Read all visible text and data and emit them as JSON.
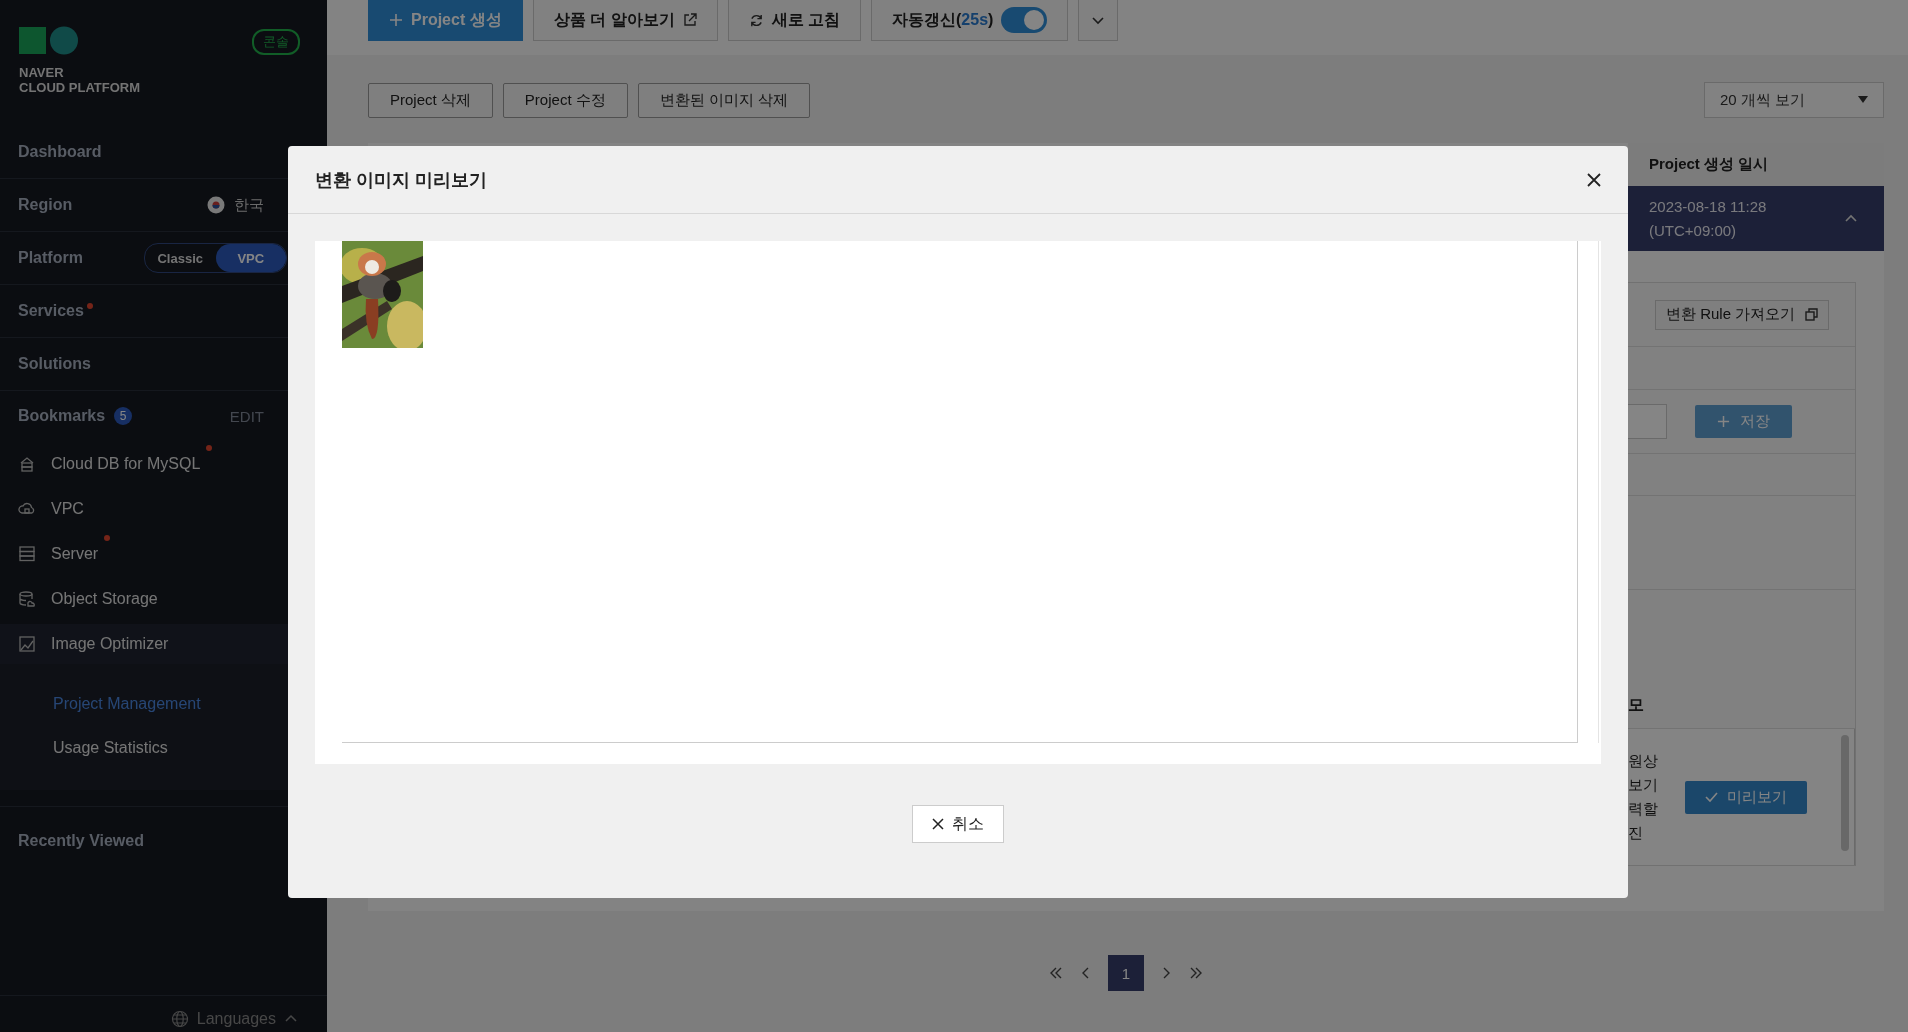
{
  "sidebar": {
    "logo": {
      "line1": "NAVER",
      "line2": "CLOUD PLATFORM"
    },
    "console_badge": "콘솔",
    "sections": [
      {
        "kind": "link",
        "label": "Dashboard",
        "new": false
      },
      {
        "kind": "region",
        "label": "Region",
        "value": "한국"
      },
      {
        "kind": "platform",
        "label": "Platform",
        "options": [
          {
            "label": "Classic",
            "selected": false
          },
          {
            "label": "VPC",
            "selected": true
          }
        ]
      },
      {
        "kind": "link",
        "label": "Services",
        "new": true
      },
      {
        "kind": "link",
        "label": "Solutions",
        "new": false
      }
    ],
    "bookmarks": {
      "label": "Bookmarks",
      "count": "5",
      "edit": "EDIT",
      "items": [
        {
          "kind": "cloud-db",
          "label": "Cloud DB for MySQL",
          "new": true,
          "expanded": false
        },
        {
          "kind": "vpc",
          "label": "VPC",
          "new": false,
          "expanded": false
        },
        {
          "kind": "server",
          "label": "Server",
          "new": true,
          "expanded": false
        },
        {
          "kind": "storage",
          "label": "Object Storage",
          "new": false,
          "expanded": false
        },
        {
          "kind": "optimizer",
          "label": "Image Optimizer",
          "new": false,
          "expanded": true,
          "children": [
            {
              "label": "Project Management",
              "selected": true
            },
            {
              "label": "Usage Statistics",
              "selected": false
            }
          ]
        }
      ]
    },
    "recent": "Recently Viewed",
    "languages": "Languages"
  },
  "toolbar": {
    "buttons": [
      {
        "kind": "primary",
        "label": "Project 생성"
      },
      {
        "kind": "external",
        "label": "상품 더 알아보기"
      },
      {
        "kind": "refresh",
        "label": "새로 고침"
      }
    ],
    "auto_refresh": {
      "label": "자동갱신(",
      "countdown": "25s",
      "close": ")",
      "on": true
    }
  },
  "actions": [
    "Project 삭제",
    "Project 수정",
    "변환된 이미지 삭제"
  ],
  "page_size": "20 개씩 보기",
  "table": {
    "columns": [
      "Project 생성 일시"
    ],
    "rows": [
      {
        "created": "2023-08-18 11:28",
        "timezone": "(UTC+09:00)",
        "selected": true,
        "expanded": true
      }
    ]
  },
  "detail": {
    "import_button": "변환 Rule 가져오기",
    "save_button": {
      "label": "저장",
      "disabled": true
    },
    "memo_label": "모",
    "memo_lines": [
      "원상",
      "보기",
      "력할",
      "진"
    ],
    "preview_button": "미리보기"
  },
  "pagination": {
    "pages": [
      {
        "label": "1",
        "selected": true
      }
    ]
  },
  "modal": {
    "title": "변환 이미지 미리보기",
    "cancel": "취소"
  }
}
